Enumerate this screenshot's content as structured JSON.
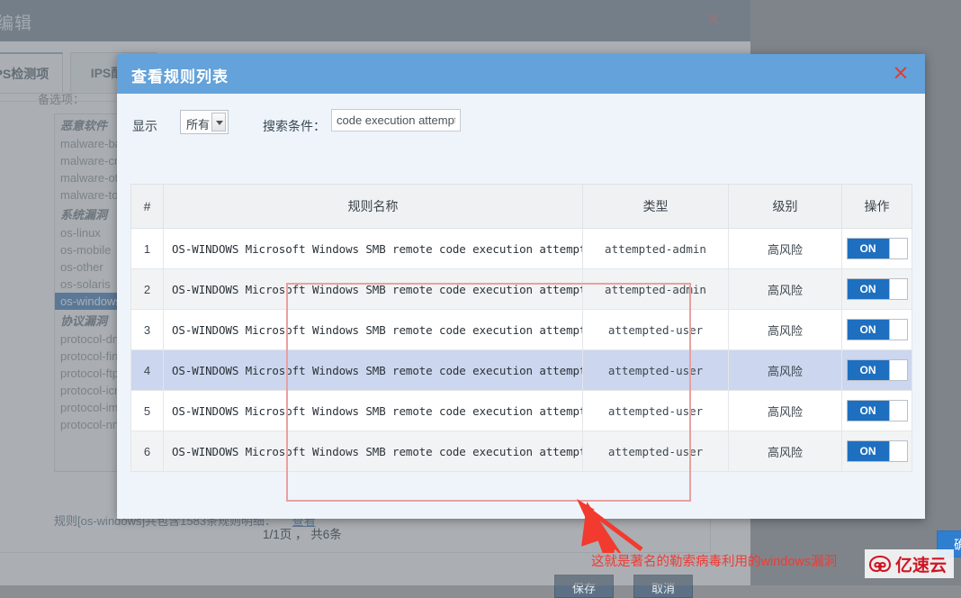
{
  "background": {
    "window_title": "编辑",
    "close_icon": "×",
    "tabs": [
      {
        "label": "IPS检测项",
        "active": true
      },
      {
        "label": "IPS配置",
        "active": false
      }
    ],
    "sub_label": "备选项：",
    "list": [
      {
        "label": "恶意软件",
        "type": "group"
      },
      {
        "label": "malware-backdoor",
        "type": "item"
      },
      {
        "label": "malware-cnc",
        "type": "item"
      },
      {
        "label": "malware-other",
        "type": "item"
      },
      {
        "label": "malware-tools",
        "type": "item"
      },
      {
        "label": "系统漏洞",
        "type": "group"
      },
      {
        "label": "os-linux",
        "type": "item"
      },
      {
        "label": "os-mobile",
        "type": "item"
      },
      {
        "label": "os-other",
        "type": "item"
      },
      {
        "label": "os-solaris",
        "type": "item"
      },
      {
        "label": "os-windows",
        "type": "item",
        "selected": true
      },
      {
        "label": "协议漏洞",
        "type": "group"
      },
      {
        "label": "protocol-dns",
        "type": "item"
      },
      {
        "label": "protocol-finger",
        "type": "item"
      },
      {
        "label": "protocol-ftp",
        "type": "item"
      },
      {
        "label": "protocol-icmp",
        "type": "item"
      },
      {
        "label": "protocol-imap",
        "type": "item"
      },
      {
        "label": "protocol-nntp",
        "type": "item"
      }
    ],
    "footnote": "规则[os-windows]共包含1583条规则明细：",
    "footnote_link": "查看",
    "buttons": {
      "ok": "保存",
      "cancel": "取消"
    }
  },
  "modal": {
    "title": "查看规则列表",
    "close_icon": "×",
    "toolbar": {
      "show_label": "显示",
      "show_value": "所有",
      "show_options": [
        "所有"
      ],
      "search_label": "搜索条件：",
      "search_value": "code execution attempt",
      "search_placeholder": ""
    },
    "table": {
      "headers": [
        "#",
        "规则名称",
        "类型",
        "级别",
        "操作"
      ],
      "rows": [
        {
          "idx": "1",
          "rule": "OS-WINDOWS Microsoft Windows SMB remote code execution attempt",
          "type": "attempted-admin",
          "level": "高风险",
          "toggle": "ON"
        },
        {
          "idx": "2",
          "rule": "OS-WINDOWS Microsoft Windows SMB remote code execution attempt",
          "type": "attempted-admin",
          "level": "高风险",
          "toggle": "ON"
        },
        {
          "idx": "3",
          "rule": "OS-WINDOWS Microsoft Windows SMB remote code execution attempt",
          "type": "attempted-user",
          "level": "高风险",
          "toggle": "ON"
        },
        {
          "idx": "4",
          "rule": "OS-WINDOWS Microsoft Windows SMB remote code execution attempt",
          "type": "attempted-user",
          "level": "高风险",
          "toggle": "ON"
        },
        {
          "idx": "5",
          "rule": "OS-WINDOWS Microsoft Windows SMB remote code execution attempt",
          "type": "attempted-user",
          "level": "高风险",
          "toggle": "ON"
        },
        {
          "idx": "6",
          "rule": "OS-WINDOWS Microsoft Windows SMB remote code execution attempt",
          "type": "attempted-user",
          "level": "高风险",
          "toggle": "ON"
        }
      ]
    },
    "pager": "1/1页 ，  共6条",
    "confirm_label": "确定"
  },
  "annotation": {
    "text": "这就是著名的勒索病毒利用的windows漏洞",
    "color": "#ef3b36",
    "box_color": "#e8a0a0"
  },
  "watermark": {
    "text": "亿速云",
    "color": "#cf1524"
  }
}
